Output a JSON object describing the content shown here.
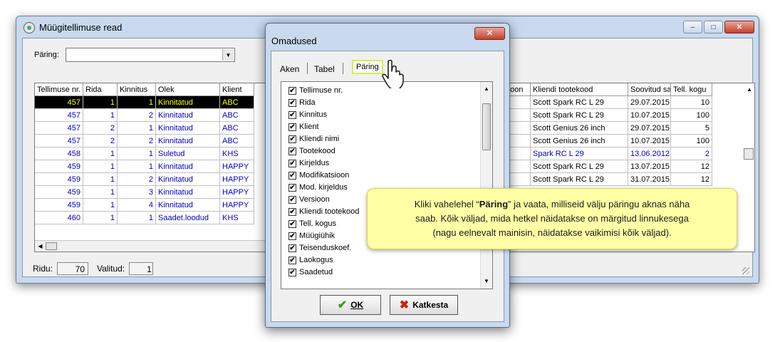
{
  "main": {
    "title": "Müügitellimuse read",
    "query_label": "Päring:",
    "query_value": "",
    "controls": {
      "minimize": "–",
      "maximize": "□",
      "close": "✕"
    },
    "left_columns": [
      "Tellimuse nr.",
      "Rida",
      "Kinnitus",
      "Olek",
      "Klient"
    ],
    "right_columns": [
      "fikatsioon",
      "Kliendi tootekood",
      "Soovitud saa",
      "Tell. kogu"
    ],
    "rows": [
      {
        "order": "457",
        "row": "1",
        "conf": "1",
        "state": "Kinnitatud",
        "client": "ABC",
        "code": "Scott Spark RC L 29",
        "date": "29.07.2015",
        "qty": "10"
      },
      {
        "order": "457",
        "row": "1",
        "conf": "2",
        "state": "Kinnitatud",
        "client": "ABC",
        "code": "Scott Spark RC L 29",
        "date": "10.07.2015",
        "qty": "100"
      },
      {
        "order": "457",
        "row": "2",
        "conf": "1",
        "state": "Kinnitatud",
        "client": "ABC",
        "code": "Scott Genius 26 inch",
        "date": "29.07.2015",
        "qty": "5"
      },
      {
        "order": "457",
        "row": "2",
        "conf": "2",
        "state": "Kinnitatud",
        "client": "ABC",
        "code": "Scott Genius 26 inch",
        "date": "10.07.2015",
        "qty": "100"
      },
      {
        "order": "458",
        "row": "1",
        "conf": "1",
        "state": "Suletud",
        "client": "KHS",
        "code": "Spark RC L 29",
        "date": "13.06.2012",
        "qty": "2"
      },
      {
        "order": "459",
        "row": "1",
        "conf": "1",
        "state": "Kinnitatud",
        "client": "HAPPY",
        "code": "Scott Spark RC L 29",
        "date": "13.07.2015",
        "qty": "12"
      },
      {
        "order": "459",
        "row": "1",
        "conf": "2",
        "state": "Kinnitatud",
        "client": "HAPPY",
        "code": "Scott Spark RC L 29",
        "date": "31.07.2015",
        "qty": "12"
      },
      {
        "order": "459",
        "row": "1",
        "conf": "3",
        "state": "Kinnitatud",
        "client": "HAPPY",
        "code": "",
        "date": "",
        "qty": ""
      },
      {
        "order": "459",
        "row": "1",
        "conf": "4",
        "state": "Kinnitatud",
        "client": "HAPPY",
        "code": "",
        "date": "",
        "qty": ""
      },
      {
        "order": "460",
        "row": "1",
        "conf": "1",
        "state": "Saadet.loodud",
        "client": "KHS",
        "code": "",
        "date": "",
        "qty": ""
      }
    ],
    "status": {
      "rows_label": "Ridu:",
      "rows_value": "70",
      "selected_label": "Valitud:",
      "selected_value": "1"
    }
  },
  "dialog": {
    "title": "Omadused",
    "close": "✕",
    "tabs": [
      "Aken",
      "Tabel",
      "Päring"
    ],
    "fields": [
      "Tellimuse nr.",
      "Rida",
      "Kinnitus",
      "Klient",
      "Kliendi nimi",
      "Tootekood",
      "Kirjeldus",
      "Modifikatsioon",
      "Mod. kirjeldus",
      "Versioon",
      "Kliendi tootekood",
      "Tell. kogus",
      "Müügiühik",
      "Teisenduskoef.",
      "Laokogus",
      "Saadetud"
    ],
    "ok_label": "OK",
    "cancel_label": "Katkesta"
  },
  "callout": {
    "line1_pre": "Kliki vahelehel “",
    "line1_bold": "Päring",
    "line1_post": "” ja vaata, milliseid välju päringu aknas näha",
    "line2": "saab. Kõik väljad, mida hetkel näidatakse on märgitud linnukesega",
    "line3": "(nagu eelnevalt mainisin, näidatakse vaikimisi kõik väljad)."
  },
  "colors": {
    "selected_bg": "#000000",
    "selected_fg": "#ffff00",
    "link_blue": "#0000c8",
    "callout_bg": "#ffffa6",
    "tab_highlight": "#d8ef4a"
  }
}
